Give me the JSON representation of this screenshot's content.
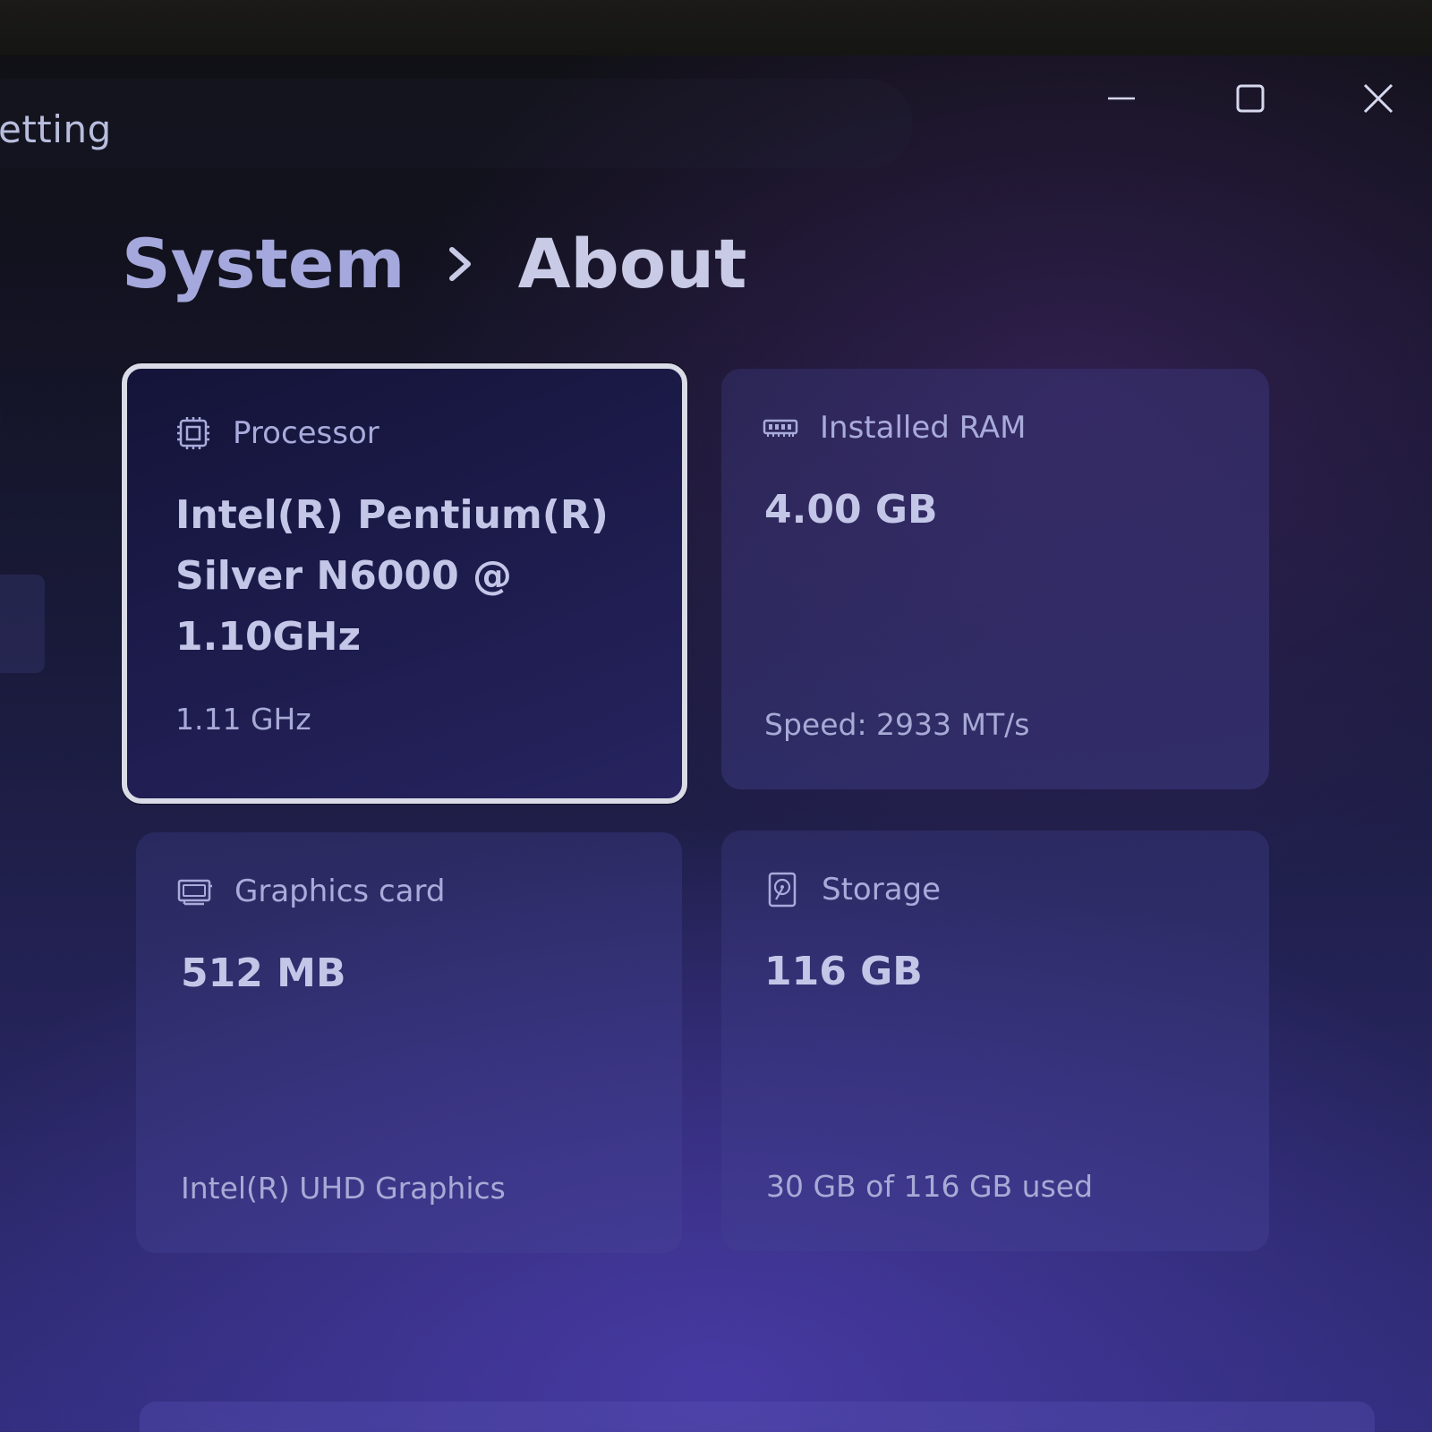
{
  "window": {
    "title_partial": "etting",
    "controls": {
      "minimize": "minimize-icon",
      "maximize": "maximize-icon",
      "close": "close-icon"
    }
  },
  "breadcrumb": {
    "parent": "System",
    "current": "About"
  },
  "specs": {
    "processor": {
      "label": "Processor",
      "value_lines": [
        "Intel(R) Pentium(R)",
        "Silver N6000 @",
        "1.10GHz"
      ],
      "sub": "1.11 GHz",
      "icon": "processor-chip-icon"
    },
    "ram": {
      "label": "Installed RAM",
      "value": "4.00 GB",
      "sub": "Speed: 2933 MT/s",
      "icon": "memory-module-icon"
    },
    "graphics": {
      "label": "Graphics card",
      "value": "512 MB",
      "sub": "Intel(R) UHD Graphics",
      "icon": "graphics-card-icon"
    },
    "storage": {
      "label": "Storage",
      "value": "116 GB",
      "sub": "30 GB of 116 GB used",
      "icon": "hard-drive-icon"
    }
  },
  "colors": {
    "accent_border": "#d9dbe6",
    "text_primary": "#c4c6e8",
    "text_secondary": "#a9abdb"
  }
}
